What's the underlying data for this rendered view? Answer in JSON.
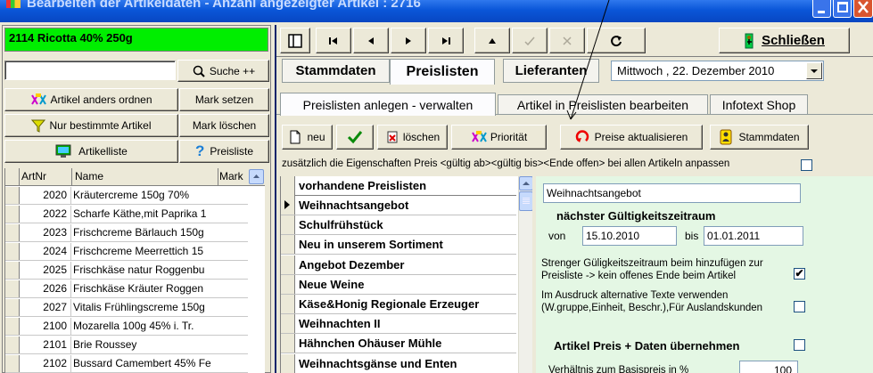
{
  "window": {
    "title": "Bearbeiten der Artikeldaten - Anzahl angezeigter Artikel : 2716",
    "minimize_icon": "minimize-icon",
    "maximize_icon": "maximize-icon",
    "close_icon": "close-icon"
  },
  "current_article": "2114 Ricotta 40% 250g",
  "search": {
    "value": "",
    "button_label": "Suche ++",
    "button_icon": "search-icon"
  },
  "left_buttons": {
    "sort_label": "Artikel anders ordnen",
    "sort_icon": "sort-icon",
    "mark_set_label": "Mark setzen",
    "filter_label": "Nur bestimmte Artikel",
    "filter_icon": "filter-icon",
    "mark_delete_label": "Mark löschen",
    "list_label": "Artikelliste",
    "list_icon": "monitor-icon",
    "pricelist_label": "Preisliste",
    "pricelist_icon": "question-icon"
  },
  "article_grid": {
    "headers": [
      "ArtNr",
      "Name",
      "Mark"
    ],
    "rows": [
      {
        "nr": "2020",
        "name": "Kräutercreme 150g 70%"
      },
      {
        "nr": "2022",
        "name": "Scharfe Käthe,mit Paprika 1"
      },
      {
        "nr": "2023",
        "name": "Frischcreme Bärlauch 150g"
      },
      {
        "nr": "2024",
        "name": "Frischcreme Meerrettich 15"
      },
      {
        "nr": "2025",
        "name": "Frischkäse natur Roggenbu"
      },
      {
        "nr": "2026",
        "name": "Frischkäse Kräuter Roggen"
      },
      {
        "nr": "2027",
        "name": "Vitalis Frühlingscreme 150g"
      },
      {
        "nr": "2100",
        "name": "Mozarella 100g 45% i. Tr."
      },
      {
        "nr": "2101",
        "name": "Brie Roussey"
      },
      {
        "nr": "2102",
        "name": "Bussard Camembert 45% Fe"
      }
    ]
  },
  "nav_toolbar": {
    "icons": [
      "layout-icon",
      "first-record-icon",
      "previous-record-icon",
      "next-record-icon",
      "last-record-icon",
      "up-icon",
      "confirm-disabled-icon",
      "cancel-disabled-icon",
      "refresh-icon"
    ],
    "close_label": "Schließen",
    "close_icon": "exit-icon"
  },
  "main_tabs": [
    "Stammdaten",
    "Preislisten",
    "Lieferanten"
  ],
  "date_select": "Mittwoch , 22. Dezember 2010",
  "sub_tabs": [
    "Preislisten anlegen - verwalten",
    "Artikel in Preislisten bearbeiten",
    "Infotext Shop"
  ],
  "action_toolbar": {
    "new_label": "neu",
    "new_icon": "new-document-icon",
    "confirm_icon": "checkmark-icon",
    "delete_label": "löschen",
    "delete_icon": "delete-icon",
    "priority_label": "Priorität",
    "priority_icon": "priority-icon",
    "update_prices_label": "Preise aktualisieren",
    "update_prices_icon": "refresh-red-icon",
    "master_data_label": "Stammdaten",
    "master_data_icon": "master-data-icon"
  },
  "adjust_all_text": "zusätzlich die Eigenschaften Preis <gültig ab><gültig bis><Ende offen> bei allen Artikeln anpassen",
  "price_lists": {
    "header": "vorhandene Preislisten",
    "items": [
      "Weihnachtsangebot",
      "Schulfrühstück",
      "Neu in unserem Sortiment",
      "Angebot Dezember",
      "Neue Weine",
      "Käse&Honig Regionale Erzeuger",
      "Weihnachten II",
      "Hähnchen Ohäuser Mühle",
      "Weihnachtsgänse und Enten"
    ],
    "selected_index": 0
  },
  "details": {
    "name_value": "Weihnachtsangebot",
    "validity_heading": "nächster Gültigkeitszeitraum",
    "from_label": "von",
    "from_value": "15.10.2010",
    "to_label": "bis",
    "to_value": "01.01.2011",
    "strict_label": "Strenger Güligkeitszeitraum beim hinzufügen zur Preisliste -> kein offenes Ende beim Artikel",
    "strict_checked": true,
    "alt_text_label": "Im Ausdruck alternative Texte verwenden (W.gruppe,Einheit, Beschr.),Für Auslandskunden",
    "alt_text_checked": false,
    "take_over_label": "Artikel Preis + Daten übernehmen",
    "take_over_checked": false,
    "ratio_label": "Verhältnis zum Basispreis in %",
    "ratio_value": "100"
  },
  "colors": {
    "title_blue": "#0a56d8",
    "current_green": "#00ee00",
    "details_green": "#e4f7e4",
    "face": "#ece9d8"
  }
}
